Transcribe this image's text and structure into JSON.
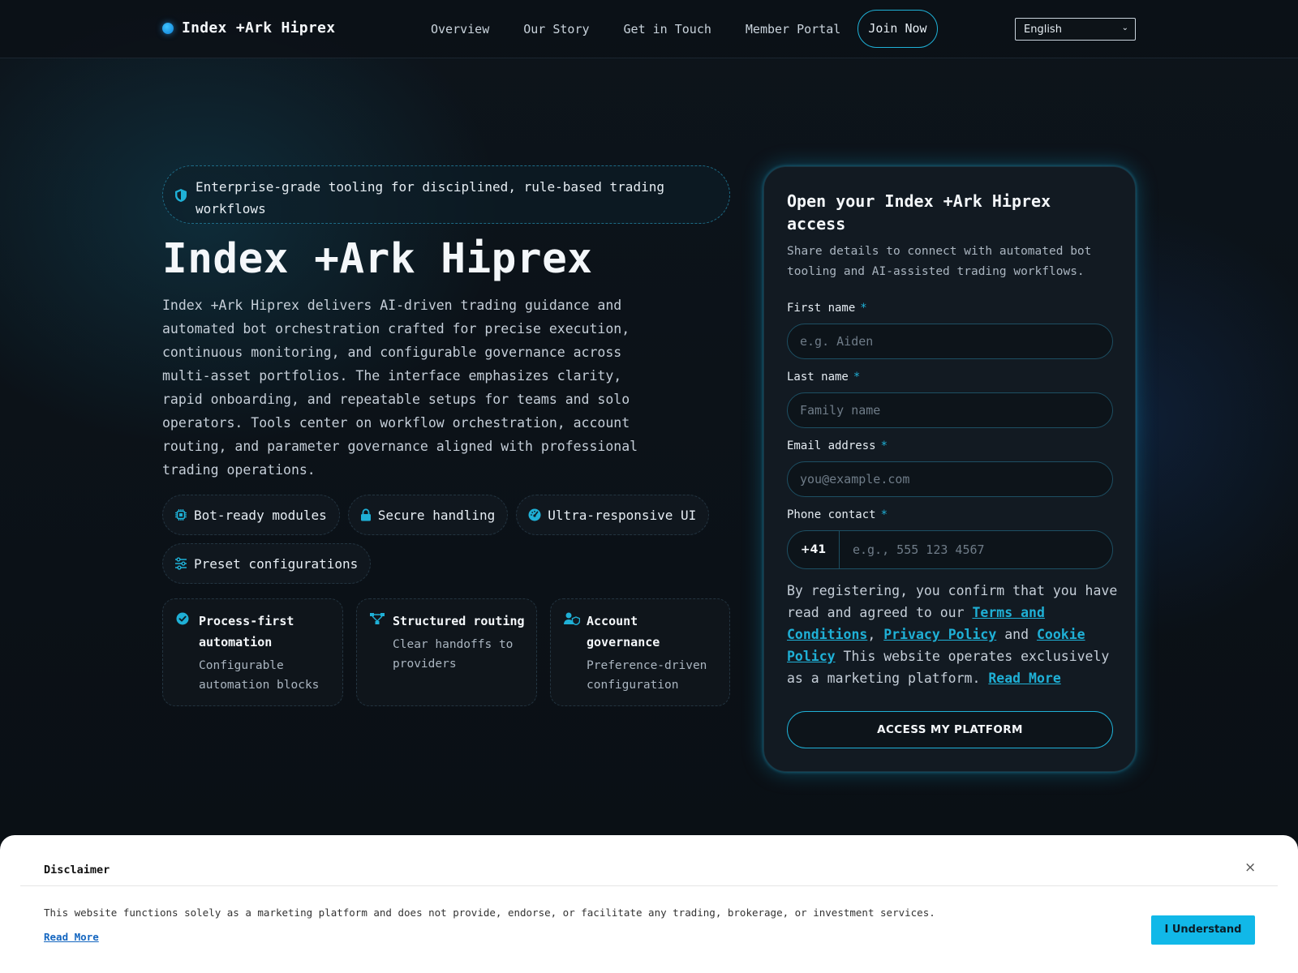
{
  "nav": {
    "brand": "Index +Ark Hiprex",
    "links": [
      "Overview",
      "Our Story",
      "Get in Touch",
      "Member Portal"
    ],
    "join": "Join Now",
    "language": "English"
  },
  "hero": {
    "badge": "Enterprise-grade tooling for disciplined, rule-based trading workflows",
    "title": "Index +Ark Hiprex",
    "lead": "Index +Ark Hiprex delivers AI-driven trading guidance and automated bot orchestration crafted for precise execution, continuous monitoring, and configurable governance across multi-asset portfolios. The interface emphasizes clarity, rapid onboarding, and repeatable setups for teams and solo operators. Tools center on workflow orchestration, account routing, and parameter governance aligned with professional trading operations.",
    "pills": [
      {
        "icon": "chip-icon",
        "label": "Bot-ready modules"
      },
      {
        "icon": "lock-icon",
        "label": "Secure handling"
      },
      {
        "icon": "gauge-icon",
        "label": "Ultra-responsive UI"
      },
      {
        "icon": "sliders-icon",
        "label": "Preset configurations"
      }
    ],
    "cards": [
      {
        "icon": "check-circle-icon",
        "title": "Process-first automation",
        "desc": "Configurable automation blocks"
      },
      {
        "icon": "routing-icon",
        "title": "Structured routing",
        "desc": "Clear handoffs to providers"
      },
      {
        "icon": "user-shield-icon",
        "title": "Account governance",
        "desc": "Preference-driven configuration"
      }
    ]
  },
  "form": {
    "title": "Open your Index +Ark Hiprex access",
    "subtitle": "Share details to connect with automated bot tooling and AI-assisted trading workflows.",
    "first_name_label": "First name",
    "first_name_placeholder": "e.g. Aiden",
    "last_name_label": "Last name",
    "last_name_placeholder": "Family name",
    "email_label": "Email address",
    "email_placeholder": "you@example.com",
    "phone_label": "Phone contact",
    "phone_code": "+41",
    "phone_placeholder": "e.g., 555 123 4567",
    "required_mark": "*",
    "legal_1": "By registering, you confirm that you have read and agreed to our ",
    "terms": "Terms and Conditions",
    "comma": ", ",
    "privacy": "Privacy Policy",
    "and": " and ",
    "cookie": "Cookie Policy",
    "legal_2": " This website operates exclusively as a marketing platform. ",
    "read_more": "Read More",
    "submit": "ACCESS MY PLATFORM"
  },
  "disclaimer": {
    "title": "Disclaimer",
    "close": "×",
    "text": "This website functions solely as a marketing platform and does not provide, endorse, or facilitate any trading, brokerage, or investment services.",
    "link": "Read More",
    "button": "I Understand"
  },
  "colors": {
    "accent": "#1fb0d6",
    "background": "#0b1117",
    "panel": "#121a22",
    "button": "#11b8e8"
  }
}
